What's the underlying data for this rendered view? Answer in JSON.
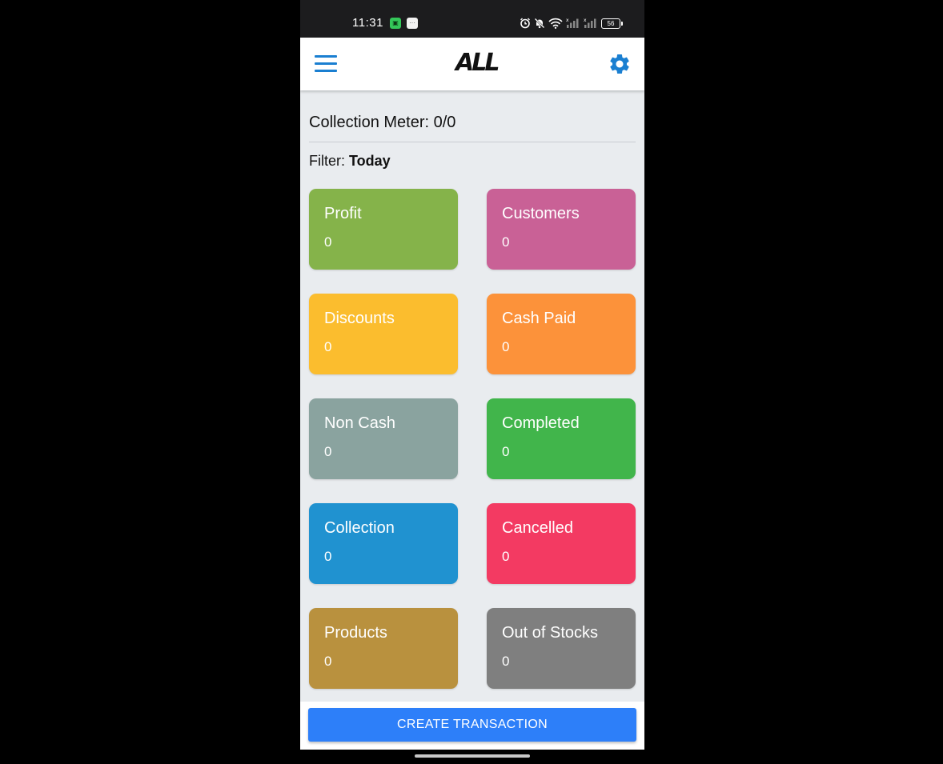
{
  "status_bar": {
    "time": "11:31",
    "battery": "56",
    "icons": [
      "alarm-icon",
      "mute-icon",
      "wifi-icon",
      "signal-icon",
      "signal-icon",
      "battery-icon"
    ]
  },
  "header": {
    "menu_icon": "hamburger-menu-icon",
    "logo_text": "ALL",
    "settings_icon": "gear-icon"
  },
  "summary": {
    "collection_meter": "Collection Meter: 0/0",
    "filter_label": "Filter:",
    "filter_value": "Today"
  },
  "cards": [
    {
      "title": "Profit",
      "value": "0",
      "color": "#85b34a"
    },
    {
      "title": "Customers",
      "value": "0",
      "color": "#c96196"
    },
    {
      "title": "Discounts",
      "value": "0",
      "color": "#fbbd2e"
    },
    {
      "title": "Cash Paid",
      "value": "0",
      "color": "#fc923a"
    },
    {
      "title": "Non Cash",
      "value": "0",
      "color": "#8aa39f"
    },
    {
      "title": "Completed",
      "value": "0",
      "color": "#41b54b"
    },
    {
      "title": "Collection",
      "value": "0",
      "color": "#2092d0"
    },
    {
      "title": "Cancelled",
      "value": "0",
      "color": "#f33a62"
    },
    {
      "title": "Products",
      "value": "0",
      "color": "#b9913e"
    },
    {
      "title": "Out of Stocks",
      "value": "0",
      "color": "#7f7f7f"
    }
  ],
  "footer": {
    "create_button": "CREATE TRANSACTION"
  },
  "colors": {
    "accent": "#1a7fd1",
    "button": "#2d7ff9",
    "background": "#e9ecef"
  }
}
